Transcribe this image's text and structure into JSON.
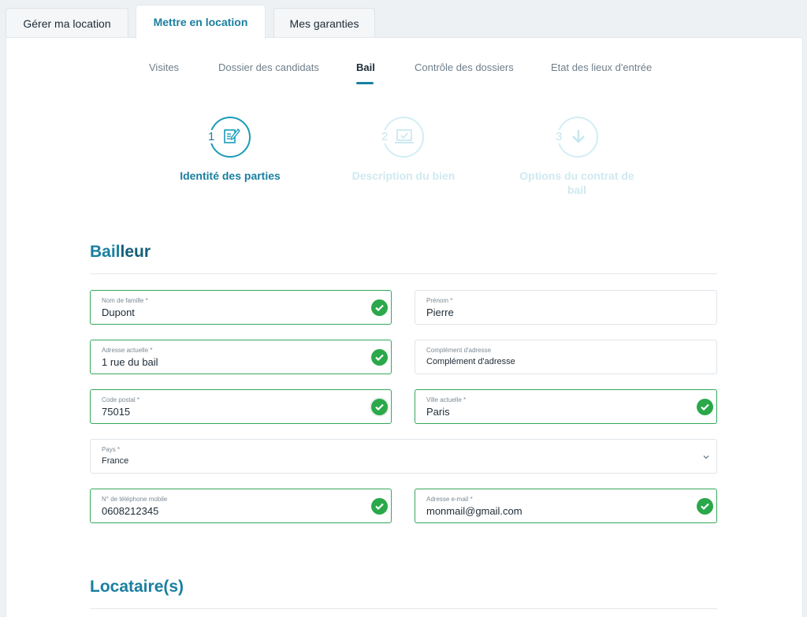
{
  "top_tabs": [
    {
      "label": "Gérer ma location"
    },
    {
      "label": "Mettre en location"
    },
    {
      "label": "Mes garanties"
    }
  ],
  "subnav": [
    {
      "label": "Visites"
    },
    {
      "label": "Dossier des candidats"
    },
    {
      "label": "Bail"
    },
    {
      "label": "Contrôle des dossiers"
    },
    {
      "label": "Etat des lieux d'entrée"
    }
  ],
  "steps": [
    {
      "number": "1",
      "label": "Identité des parties",
      "icon": "edit-document-icon",
      "state": "active"
    },
    {
      "number": "2",
      "label": "Description du bien",
      "icon": "laptop-check-icon",
      "state": "inactive"
    },
    {
      "number": "3",
      "label_line1": "Options du contrat de",
      "label_line2": "bail",
      "icon": "arrow-down-icon",
      "state": "inactive"
    }
  ],
  "bailleur": {
    "title_a": "Bail",
    "title_b": "leur",
    "fields": {
      "nom": {
        "label": "Nom de famille *",
        "value": "Dupont"
      },
      "prenom": {
        "label": "Prénom *",
        "value": "Pierre"
      },
      "adresse": {
        "label": "Adresse actuelle *",
        "value": "1 rue du bail"
      },
      "complement": {
        "label": "Complément d'adresse",
        "value": "Complément d'adresse"
      },
      "code_postal": {
        "label": "Code postal *",
        "value": "75015"
      },
      "ville": {
        "label": "Ville actuelle *",
        "value": "Paris"
      },
      "pays": {
        "label": "Pays *",
        "value": "France"
      },
      "telephone": {
        "label": "N° de téléphone mobile",
        "value": "0608212345"
      },
      "email": {
        "label": "Adresse e-mail *",
        "value": "monmail@gmail.com"
      }
    }
  },
  "locataires": {
    "title": "Locataire(s)"
  },
  "colors": {
    "accent": "#1a7fa0",
    "valid": "#2aa84a",
    "valid_border": "#35a85a"
  }
}
